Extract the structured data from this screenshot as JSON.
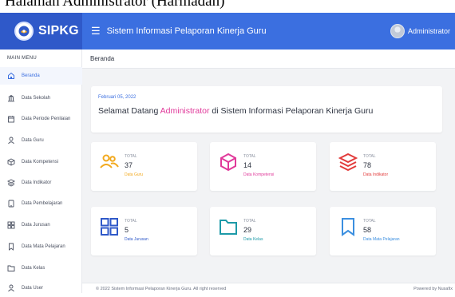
{
  "caption": "Halaman Administrator (Harmadan)",
  "brand": {
    "name": "SIPKG"
  },
  "topbar": {
    "title": "Sistem Informasi Pelaporan Kinerja Guru",
    "user": "Administrator"
  },
  "sidebar": {
    "heading": "MAIN MENU",
    "items": [
      {
        "label": "Beranda",
        "icon": "home-icon"
      },
      {
        "label": "Data Sekolah",
        "icon": "school-icon"
      },
      {
        "label": "Data Periode Penilaian",
        "icon": "calendar-icon"
      },
      {
        "label": "Data Guru",
        "icon": "user-icon"
      },
      {
        "label": "Data Kompetensi",
        "icon": "cube-icon"
      },
      {
        "label": "Data Indikator",
        "icon": "layers-icon"
      },
      {
        "label": "Data Pembelajaran",
        "icon": "tablet-icon"
      },
      {
        "label": "Data Jurusan",
        "icon": "grid-icon"
      },
      {
        "label": "Data Mata Pelajaran",
        "icon": "bookmark-icon"
      },
      {
        "label": "Data Kelas",
        "icon": "folder-icon"
      },
      {
        "label": "Data User",
        "icon": "user-icon"
      }
    ]
  },
  "breadcrumb": "Beranda",
  "welcome": {
    "date": "Februari 05, 2022",
    "prefix": "Selamat Datang ",
    "highlight": "Administrator",
    "suffix": " di Sistem Informasi Pelaporan Kinerja Guru"
  },
  "cards": [
    {
      "total_label": "TOTAL",
      "value": "37",
      "label": "Data Guru",
      "icon": "users-icon",
      "color": "#f2a91e"
    },
    {
      "total_label": "TOTAL",
      "value": "14",
      "label": "Data Kompetensi",
      "icon": "cube-icon",
      "color": "#e0399a"
    },
    {
      "total_label": "TOTAL",
      "value": "78",
      "label": "Data Indikator",
      "icon": "layers-icon",
      "color": "#e23b3b"
    },
    {
      "total_label": "TOTAL",
      "value": "5",
      "label": "Data Jurusan",
      "icon": "grid-icon",
      "color": "#2f59c9"
    },
    {
      "total_label": "TOTAL",
      "value": "29",
      "label": "Data Kelas",
      "icon": "folder-icon",
      "color": "#1d9aa8"
    },
    {
      "total_label": "TOTAL",
      "value": "58",
      "label": "Data Mata Pelajaran",
      "icon": "bookmark-icon",
      "color": "#3b8fe0"
    }
  ],
  "footer": {
    "copyright": "© 2022 Sistem Informasi Pelaporan Kinerja Guru. All right reserved",
    "powered": "Powered by Nusafix"
  },
  "colors": {
    "brand": "#2f59c9",
    "topbar": "#3b6fe0",
    "accent": "#3b6fe0",
    "highlight": "#e0399a"
  }
}
